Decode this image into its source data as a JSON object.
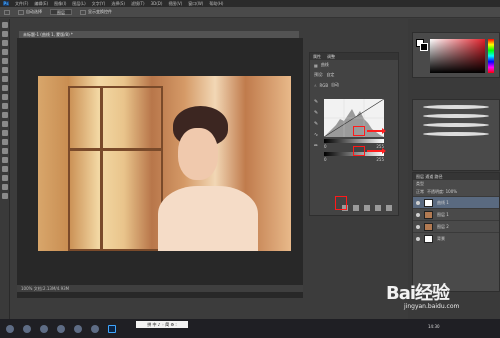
{
  "app": {
    "logo": "Ps"
  },
  "menubar": [
    "文件(F)",
    "编辑(E)",
    "图像(I)",
    "图层(L)",
    "文字(Y)",
    "选择(S)",
    "滤镜(T)",
    "3D(D)",
    "视图(V)",
    "窗口(W)",
    "帮助(H)"
  ],
  "options": {
    "auto_select": "自动选择",
    "layer": "图层",
    "transform": "显示变换控件"
  },
  "document": {
    "tab": "未标题-1 (曲线 1, 蒙版/8) *",
    "status": "100%   文档:2.13M/4.93M"
  },
  "properties": {
    "tabs": [
      "属性",
      "调整"
    ],
    "title": "曲线",
    "preset_label": "预设:",
    "preset_value": "自定",
    "channel": "RGB",
    "auto": "自动",
    "input_vals": [
      "0",
      "255"
    ],
    "output_vals": [
      "0",
      "255"
    ]
  },
  "color": {
    "fg": "#ffffff",
    "bg": "#000000"
  },
  "layers": {
    "tabs": "图层  通道  路径",
    "kind": "类型",
    "blend": "正常",
    "opacity": "不透明度: 100%",
    "items": [
      {
        "name": "曲线 1",
        "thumb": "white"
      },
      {
        "name": "图层 1",
        "thumb": "photo"
      },
      {
        "name": "图层 2",
        "thumb": "photo"
      },
      {
        "name": "背景",
        "thumb": "white"
      }
    ]
  },
  "ime": "拼 中 ♪ ◦ 简 ⚙ :",
  "taskbar": {
    "time": "14:30"
  },
  "watermark": {
    "brand": "Bai经验",
    "url": "jingyan.baidu.com"
  }
}
